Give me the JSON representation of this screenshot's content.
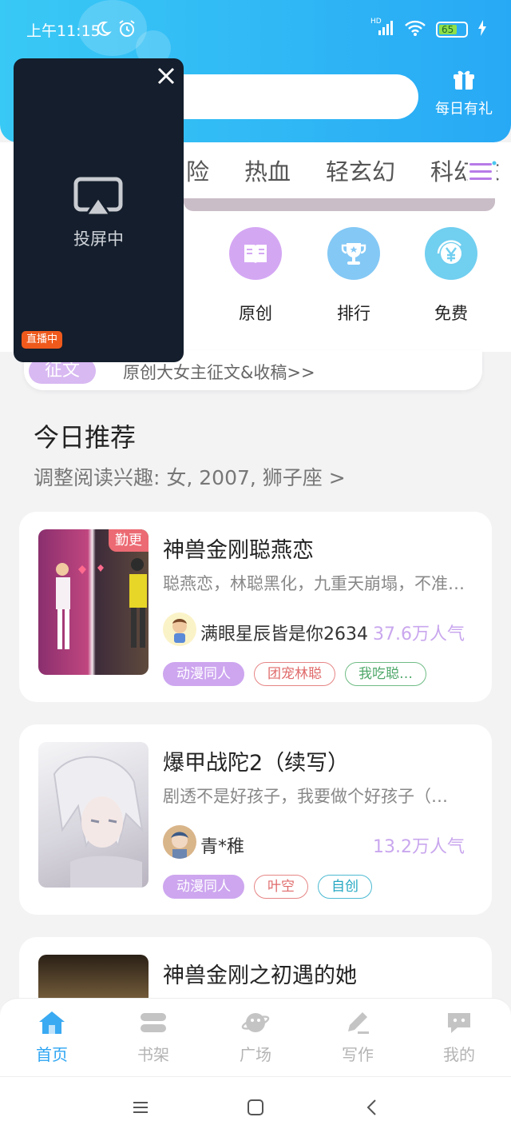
{
  "status": {
    "time": "上午11:15",
    "network": "HD",
    "battery": "65"
  },
  "header": {
    "daily_gift_label": "每日有礼"
  },
  "categories": [
    "险",
    "热血",
    "轻玄幻",
    "科幻末"
  ],
  "quick_links": [
    {
      "label": "原创",
      "icon": "book-icon",
      "color": "#d4a7f3"
    },
    {
      "label": "排行",
      "icon": "trophy-icon",
      "color": "#84c8f5"
    },
    {
      "label": "免费",
      "icon": "yen-icon",
      "color": "#71cff0"
    }
  ],
  "notice": {
    "badge": "征文",
    "text": "原创大女主征文&收稿>>"
  },
  "recommend": {
    "title": "今日推荐",
    "subtitle": "调整阅读兴趣: 女, 2007, 狮子座 >"
  },
  "books": [
    {
      "title": "神兽金刚聪燕恋",
      "desc": "聪燕恋，林聪黑化，九重天崩塌，不准…",
      "author": "满眼星辰皆是你2634",
      "popularity": "37.6万人气",
      "badge": "勤更",
      "tags": [
        {
          "label": "动漫同人",
          "style": "purple"
        },
        {
          "label": "团宠林聪",
          "style": "red"
        },
        {
          "label": "我吃聪…",
          "style": "green"
        }
      ]
    },
    {
      "title": "爆甲战陀2（续写）",
      "desc": "剧透不是好孩子，我要做个好孩子（…",
      "author": "青*稚",
      "popularity": "13.2万人气",
      "tags": [
        {
          "label": "动漫同人",
          "style": "purple"
        },
        {
          "label": "叶空",
          "style": "red"
        },
        {
          "label": "自创",
          "style": "teal"
        }
      ]
    },
    {
      "title": "神兽金刚之初遇的她"
    }
  ],
  "bottom_nav": [
    {
      "label": "首页",
      "icon": "home-icon",
      "active": true
    },
    {
      "label": "书架",
      "icon": "bookshelf-icon",
      "active": false
    },
    {
      "label": "广场",
      "icon": "planet-icon",
      "active": false
    },
    {
      "label": "写作",
      "icon": "pen-icon",
      "active": false
    },
    {
      "label": "我的",
      "icon": "chat-icon",
      "active": false
    }
  ],
  "cast_overlay": {
    "label": "投屏中",
    "live_badge": "直播中"
  },
  "colors": {
    "header_gradient_start": "#39c9f5",
    "header_gradient_end": "#28a9f5",
    "accent": "#2ea5f2",
    "popularity": "#c9a7ee"
  }
}
